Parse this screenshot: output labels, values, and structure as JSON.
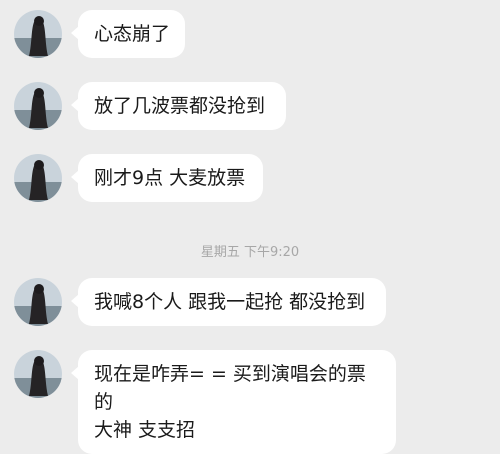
{
  "messages": [
    {
      "text": "心态崩了",
      "avatar_icon": "profile-photo-icon"
    },
    {
      "text": "放了几波票都没抢到",
      "avatar_icon": "profile-photo-icon"
    },
    {
      "text": "刚才9点 大麦放票",
      "avatar_icon": "profile-photo-icon"
    },
    {
      "text": "我喊8个人 跟我一起抢 都没抢到",
      "avatar_icon": "profile-photo-icon"
    },
    {
      "text_line1": "现在是咋弄= = 买到演唱会的票的",
      "text_line2": "大神 支支招",
      "avatar_icon": "profile-photo-icon"
    }
  ],
  "timestamp": "星期五 下午9:20",
  "colors": {
    "background": "#ececec",
    "bubble": "#ffffff",
    "text": "#1a1a1a",
    "timestamp": "#a7a7a7"
  }
}
